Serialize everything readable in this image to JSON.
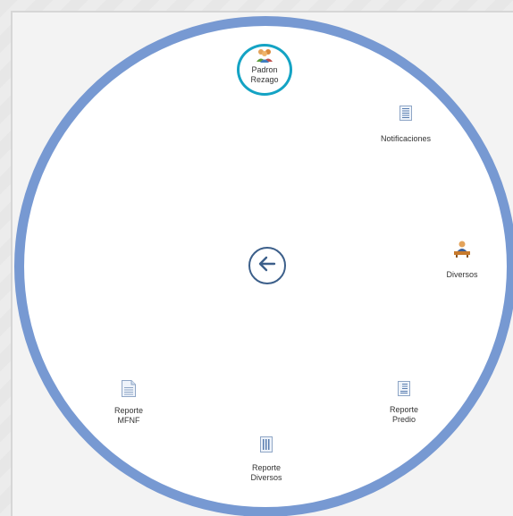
{
  "menu": {
    "items": [
      {
        "label": "Padron\nRezago",
        "icon": "people-icon"
      },
      {
        "label": "Notificaciones",
        "icon": "document-list-icon"
      },
      {
        "label": "Diversos",
        "icon": "person-at-desk-icon"
      },
      {
        "label": "Reporte\nPredio",
        "icon": "report-document-icon"
      },
      {
        "label": "Reporte\nDiversos",
        "icon": "report-list-icon"
      },
      {
        "label": "Reporte\nMFNF",
        "icon": "document-icon"
      }
    ],
    "center_button": {
      "icon": "arrow-left-icon"
    }
  },
  "colors": {
    "ring": "#7799d2",
    "highlight": "#14a3c4",
    "center": "#3c5f8a"
  }
}
